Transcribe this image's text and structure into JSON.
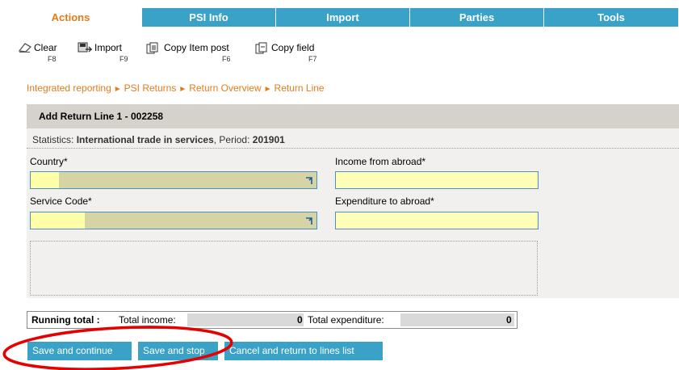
{
  "tabs": [
    "Actions",
    "PSI Info",
    "Import",
    "Parties",
    "Tools"
  ],
  "toolbar": {
    "clear": {
      "label": "Clear",
      "key": "F8"
    },
    "import": {
      "label": "Import",
      "key": "F9"
    },
    "copy_item_post": {
      "label": "Copy Item post",
      "key": "F6"
    },
    "copy_field": {
      "label": "Copy field",
      "key": "F7"
    }
  },
  "breadcrumb": [
    "Integrated reporting",
    "PSI Returns",
    "Return Overview",
    "Return Line"
  ],
  "panel": {
    "title": "Add Return Line 1 - 002258",
    "stats_label": "Statistics: ",
    "stats_value": "International trade in services",
    "period_label": ", Period: ",
    "period_value": "201901"
  },
  "fields": {
    "country_label": "Country*",
    "service_code_label": "Service Code*",
    "income_label": "Income from abroad*",
    "expenditure_label": "Expenditure to abroad*"
  },
  "totals": {
    "running_label": "Running total :",
    "income_label": "Total income:",
    "income_value": "0",
    "expenditure_label": "Total expenditure:",
    "expenditure_value": "0"
  },
  "buttons": {
    "save_continue": "Save and continue",
    "save_stop": "Save and stop",
    "cancel": "Cancel and return to lines list"
  },
  "colors": {
    "accent": "#3aa1c7",
    "highlight": "#e47b1c",
    "annotation": "#e60000"
  }
}
